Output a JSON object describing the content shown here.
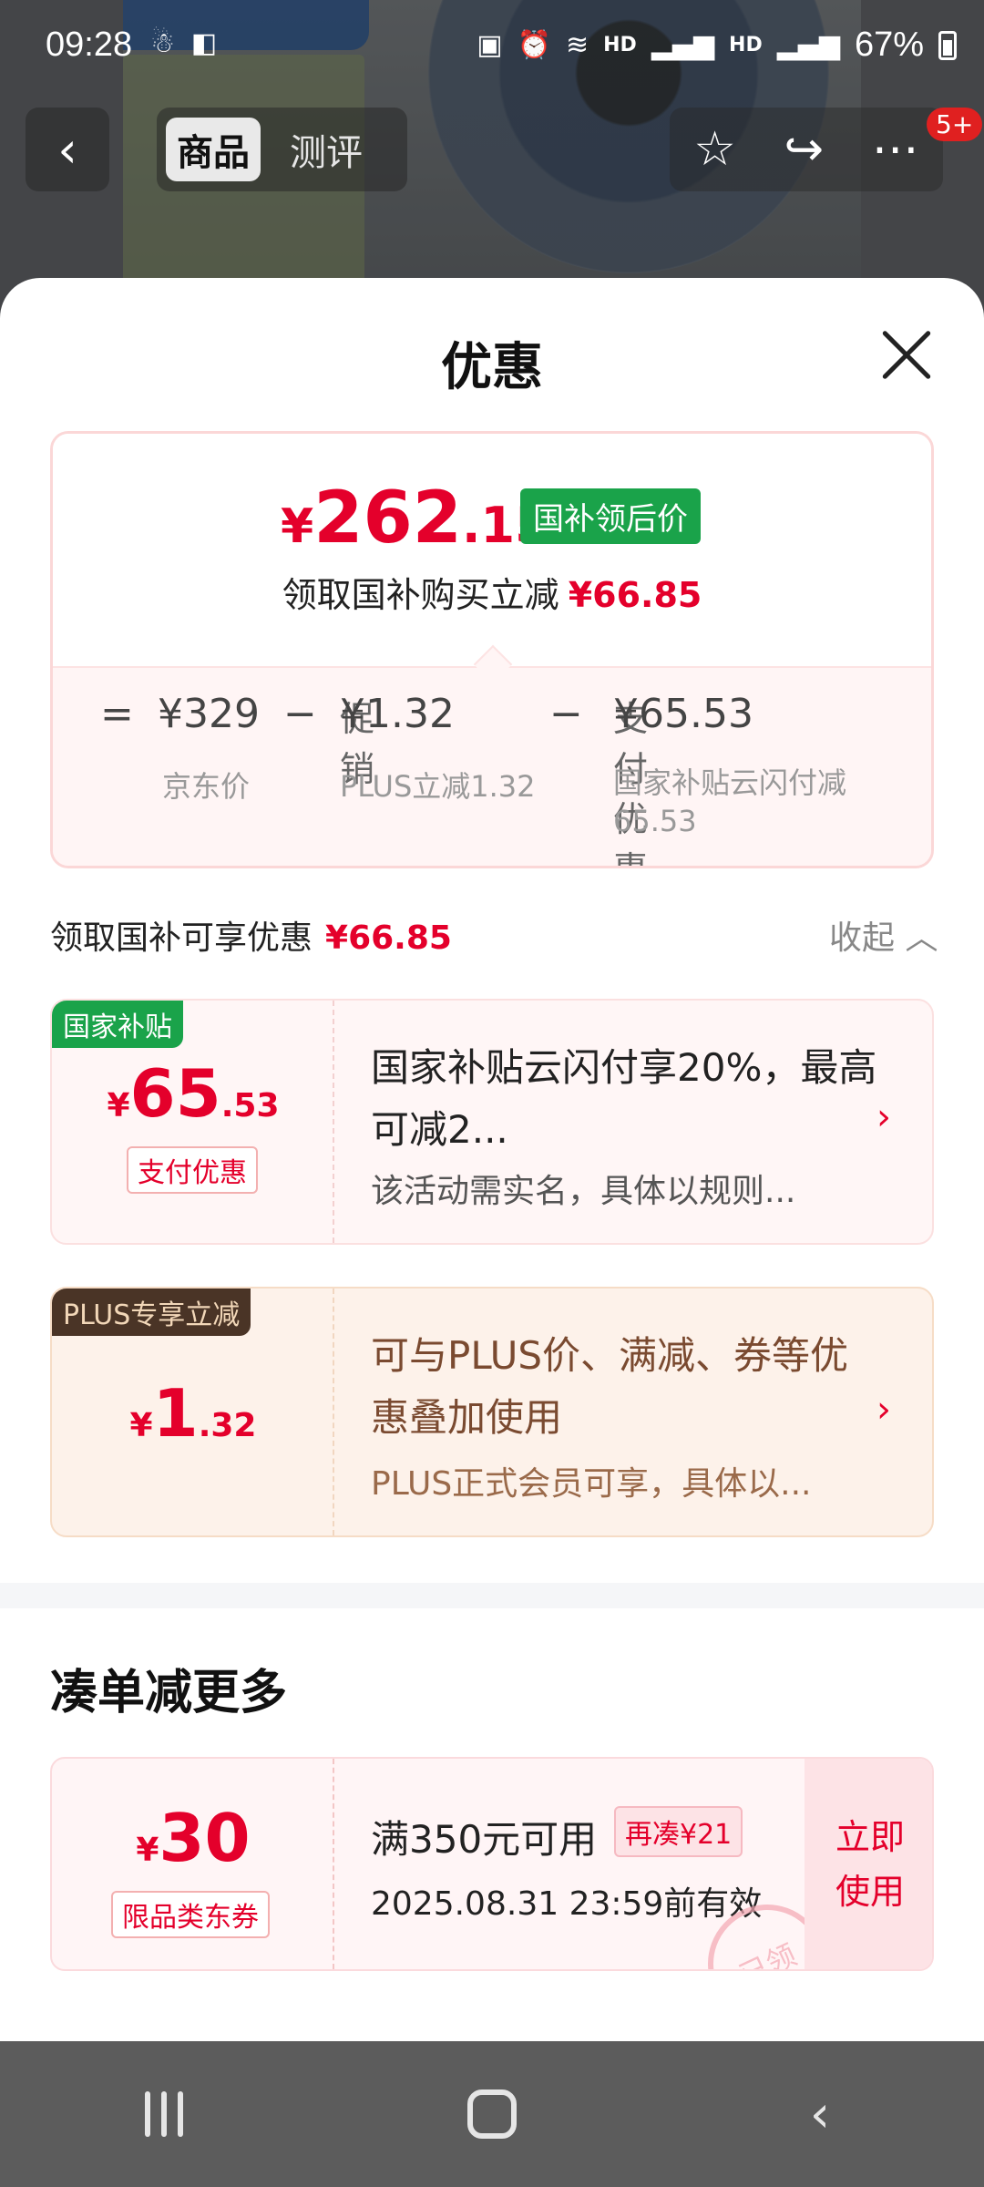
{
  "status": {
    "time": "09:28",
    "battery": "67%",
    "net1": "HD",
    "net2": "HD"
  },
  "nav": {
    "tab_product": "商品",
    "tab_review": "测评",
    "badge": "5+"
  },
  "sheet": {
    "title": "优惠"
  },
  "price_card": {
    "price_yen": "¥",
    "price_int": "262",
    "price_dec": ".15",
    "price_tag": "国补领后价",
    "sub_text": "领取国补购买立减",
    "sub_amount": "¥66.85",
    "eq": "=",
    "jd_price": "¥329",
    "minus1": "−",
    "promo_label": "促销",
    "promo_amount": "¥1.32",
    "minus2": "−",
    "pay_label": "支付优惠",
    "pay_amount": "¥65.53",
    "note_jd": "京东价",
    "note_promo": "PLUS立减1.32",
    "note_pay": "国家补贴云闪付减65.53"
  },
  "section": {
    "title": "领取国补可享优惠",
    "amount": "¥66.85",
    "collapse": "收起"
  },
  "card1": {
    "tag": "国家补贴",
    "yen": "¥",
    "int": "65",
    "dec": ".53",
    "chip": "支付优惠",
    "main": "国家补贴云闪付享20%，最高可减2...",
    "note": "该活动需实名，具体以规则..."
  },
  "card2": {
    "tag": "PLUS专享立减",
    "yen": "¥",
    "int": "1",
    "dec": ".32",
    "main": "可与PLUS价、满减、券等优惠叠加使用",
    "note": "PLUS正式会员可享，具体以..."
  },
  "more": {
    "title": "凑单减更多"
  },
  "coupon": {
    "yen": "¥",
    "int": "30",
    "chip": "限品类东券",
    "condition": "满350元可用",
    "extra": "再凑¥21",
    "expire": "2025.08.31 23:59前有效",
    "use": "立即使用",
    "stamp": "已领"
  }
}
